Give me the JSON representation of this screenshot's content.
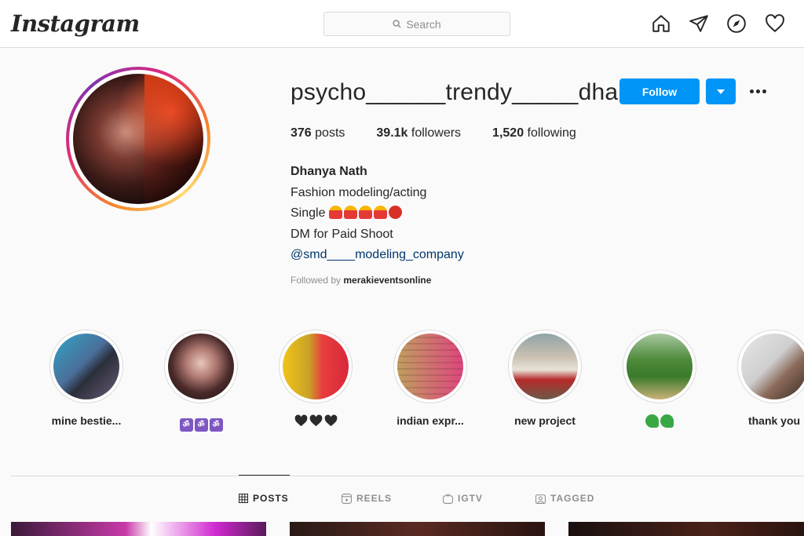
{
  "topbar": {
    "logo": "Instagram",
    "search_placeholder": "Search",
    "icons": [
      "home-icon",
      "direct-icon",
      "explore-icon",
      "activity-icon"
    ]
  },
  "profile": {
    "username": "psycho______trendy_____dhanu",
    "follow_label": "Follow",
    "stats": {
      "posts_count": "376",
      "posts_label": "posts",
      "followers_count": "39.1k",
      "followers_label": "followers",
      "following_count": "1,520",
      "following_label": "following"
    },
    "bio": {
      "name": "Dhanya Nath",
      "line1": "Fashion modeling/acting",
      "line2": "Single",
      "line3": "DM for Paid Shoot",
      "link": "@smd____modeling_company"
    },
    "followed_by_prefix": "Followed by",
    "followed_by_user": "merakieventsonline"
  },
  "highlights": [
    {
      "label": "mine bestie..."
    },
    {
      "label": ""
    },
    {
      "label": ""
    },
    {
      "label": "indian expr..."
    },
    {
      "label": "new project"
    },
    {
      "label": ""
    },
    {
      "label": "thank you"
    }
  ],
  "tabs": [
    {
      "label": "POSTS",
      "active": true
    },
    {
      "label": "REELS",
      "active": false
    },
    {
      "label": "IGTV",
      "active": false
    },
    {
      "label": "TAGGED",
      "active": false
    }
  ],
  "colors": {
    "accent": "#0095f6",
    "link": "#00376b",
    "text": "#262626",
    "muted": "#8e8e8e"
  }
}
